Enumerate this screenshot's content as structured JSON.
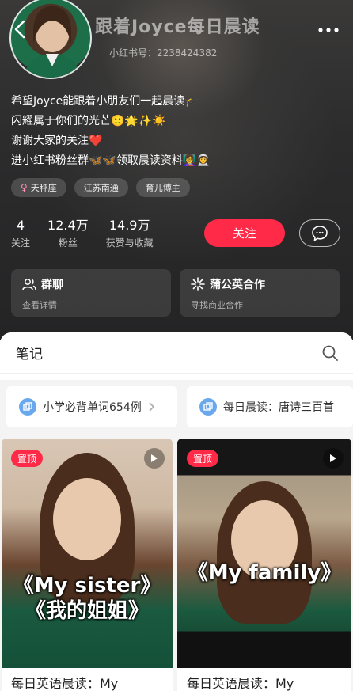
{
  "header": {
    "title": "跟着Joyce每日晨读",
    "redid": "小红书号：2238424382"
  },
  "bio": {
    "lines": [
      "希望Joyce能跟着小朋友们一起晨读🎓",
      "闪耀属于你们的光芒🙂🌟✨☀️",
      "谢谢大家的关注❤️",
      "进小红书粉丝群🦋🦋领取晨读资料👩‍🏫👩‍🚀"
    ]
  },
  "tags": [
    {
      "label": "天秤座",
      "icon": "female-icon"
    },
    {
      "label": "江苏南通"
    },
    {
      "label": "育儿博主"
    }
  ],
  "stats": [
    {
      "value": "4",
      "label": "关注"
    },
    {
      "value": "12.4万",
      "label": "粉丝"
    },
    {
      "value": "14.9万",
      "label": "获赞与收藏"
    }
  ],
  "actions": {
    "follow_label": "关注",
    "chat_icon": "chat-bubble-icon"
  },
  "cards": [
    {
      "title": "群聊",
      "subtitle": "查看详情",
      "icon": "group-icon"
    },
    {
      "title": "蒲公英合作",
      "subtitle": "寻找商业合作",
      "icon": "sparkle-icon"
    }
  ],
  "notes": {
    "section_title": "笔记",
    "collections": [
      {
        "label": "小学必背单词654例"
      },
      {
        "label": "每日晨读：唐诗三百首"
      }
    ],
    "items": [
      {
        "pin_label": "置顶",
        "overlay_lines": [
          "《My sister》",
          "《我的姐姐》"
        ],
        "title": "每日英语晨读：My"
      },
      {
        "pin_label": "置顶",
        "overlay_lines": [
          "《My family》"
        ],
        "title": "每日英语晨读：My"
      }
    ]
  },
  "colors": {
    "accent": "#ff2a48",
    "header_bg": "#2c2c2d",
    "collection_icon": "#6aa8ee"
  }
}
